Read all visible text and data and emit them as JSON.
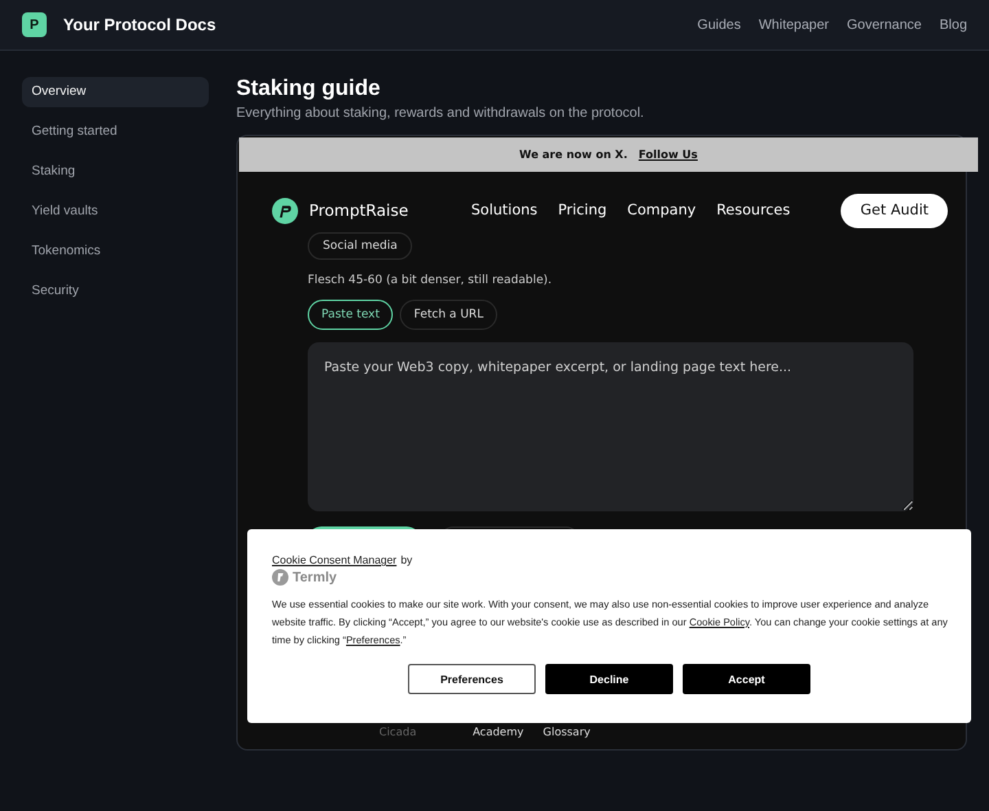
{
  "header": {
    "logo_letter": "P",
    "title": "Your Protocol Docs",
    "nav": [
      "Guides",
      "Whitepaper",
      "Governance",
      "Blog"
    ]
  },
  "sidebar": {
    "items": [
      {
        "label": "Overview",
        "selected": true
      },
      {
        "label": "Getting started",
        "selected": false
      },
      {
        "label": "Staking",
        "selected": false
      },
      {
        "label": "Yield vaults",
        "selected": false
      },
      {
        "label": "Tokenomics",
        "selected": false
      },
      {
        "label": "Security",
        "selected": false
      }
    ]
  },
  "page": {
    "title": "Staking guide",
    "subtitle": "Everything about staking, rewards and withdrawals on the protocol."
  },
  "embed": {
    "banner": {
      "text": "We are now on X.",
      "link": "Follow Us"
    },
    "brand": "PromptRaise",
    "nav": [
      "Solutions",
      "Pricing",
      "Company",
      "Resources"
    ],
    "cta": "Get Audit",
    "chip": "Social media",
    "note": "Flesch 45-60 (a bit denser, still readable).",
    "modes": [
      {
        "label": "Paste text",
        "selected": true
      },
      {
        "label": "Fetch a URL",
        "selected": false
      }
    ],
    "textarea": {
      "placeholder": "Paste your Web3 copy, whitepaper excerpt, or landing page text here..."
    },
    "footer": [
      {
        "label": "Cicada",
        "kind": "muted"
      },
      {
        "label": "Academy",
        "kind": "link"
      },
      {
        "label": "Glossary",
        "kind": "link"
      }
    ]
  },
  "cookie": {
    "manager_link": "Cookie Consent Manager",
    "by": "by",
    "brand": "Termly",
    "body": [
      {
        "text": "We use essential cookies to make our site work. With your consent, we may also use non-essential cookies to improve user experience and analyze website traffic. By clicking “Accept,” you agree to our website's cookie use as described in our ",
        "kind": "plain"
      },
      {
        "text": "Cookie Policy",
        "kind": "link"
      },
      {
        "text": ". You can change your cookie settings at any time by clicking “",
        "kind": "plain"
      },
      {
        "text": "Preferences",
        "kind": "link"
      },
      {
        "text": ".”",
        "kind": "plain"
      }
    ],
    "buttons": [
      {
        "label": "Preferences",
        "kind": "outline"
      },
      {
        "label": "Decline",
        "kind": "solid"
      },
      {
        "label": "Accept",
        "kind": "solid"
      }
    ]
  }
}
